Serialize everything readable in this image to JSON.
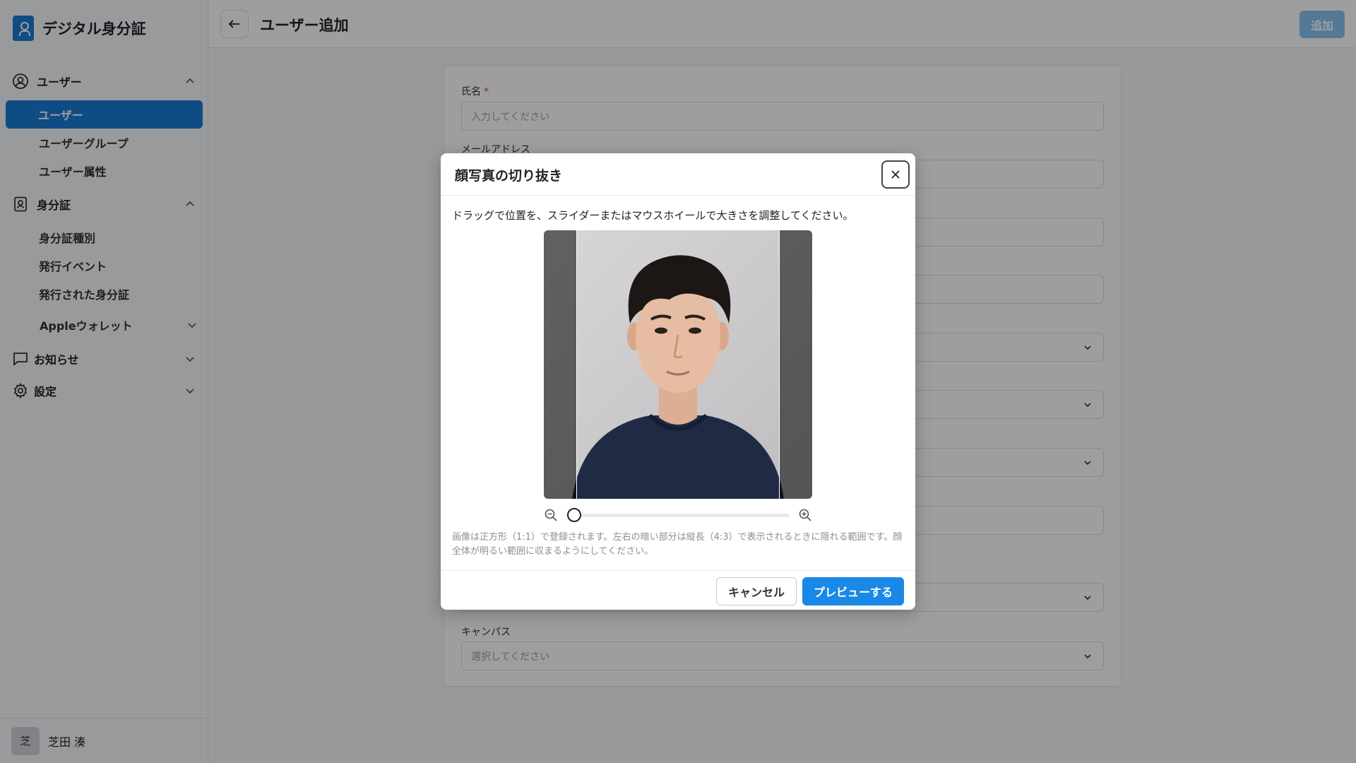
{
  "app": {
    "name": "デジタル身分証"
  },
  "sidebar": {
    "sections": [
      {
        "label": "ユーザー",
        "icon": "user-circle-icon"
      },
      {
        "label": "身分証",
        "icon": "id-card-icon"
      },
      {
        "label": "お知らせ",
        "icon": "chat-bubble-icon"
      },
      {
        "label": "設定",
        "icon": "gear-icon"
      }
    ],
    "user_items": [
      "ユーザー",
      "ユーザーグループ",
      "ユーザー属性"
    ],
    "id_items": [
      "身分証種別",
      "発行イベント",
      "発行された身分証"
    ],
    "apple_wallet": "Appleウォレット"
  },
  "footer_user": {
    "avatar": "芝",
    "name": "芝田 湊"
  },
  "header": {
    "title": "ユーザー追加",
    "add_label": "追加"
  },
  "form": {
    "name_label": "氏名",
    "required_mark": "*",
    "name_placeholder": "入力してください",
    "email_label": "メールアドレス",
    "campus_label": "キャンパス",
    "campus_placeholder": "選択してください"
  },
  "modal": {
    "title": "顔写真の切り抜き",
    "description": "ドラッグで位置を、スライダーまたはマウスホイールで大きさを調整してください。",
    "zoom_level": 0.03,
    "note": "画像は正方形（1:1）で登録されます。左右の暗い部分は縦長（4:3）で表示されるときに隠れる範囲です。顔全体が明るい範囲に収まるようにしてください。",
    "cancel_label": "キャンセル",
    "preview_label": "プレビューする"
  }
}
